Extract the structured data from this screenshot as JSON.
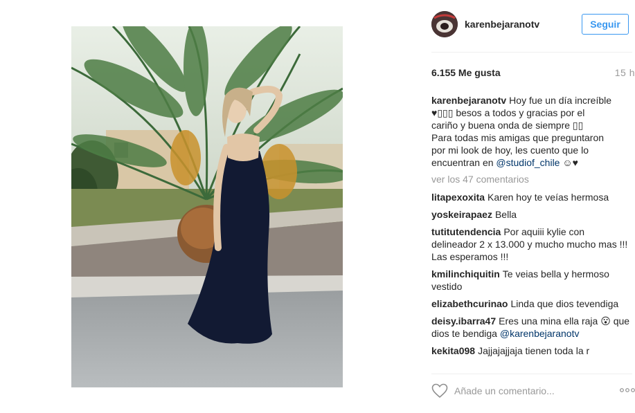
{
  "post": {
    "owner": "karenbejaranotv",
    "follow_label": "Seguir",
    "likes": "6.155 Me gusta",
    "time_ago": "15 h"
  },
  "caption": {
    "user": "karenbejaranotv",
    "line1": "Hoy fue un día increíble",
    "line2": "♥▯▯▯ besos a todos y gracias por el",
    "line3": "cariño y buena onda de siempre ▯▯",
    "line4": "Para todas mis amigas que preguntaron",
    "line5": "por mi look de hoy, les cuento que lo",
    "line6_prefix": "encuentran en",
    "line6_mention": "@studiof_chile",
    "line6_suffix": "☺♥"
  },
  "load_more": "ver los 47 comentarios",
  "comments": [
    {
      "user": "litapexoxita",
      "text": "Karen hoy te veías hermosa"
    },
    {
      "user": "yoskeirapaez",
      "text": "Bella"
    },
    {
      "user": "tutitutendencia",
      "text": "Por aquiii kylie con delineador 2 x 13.000 y mucho mucho mas !!! Las esperamos !!!"
    },
    {
      "user": "kmilinchiquitin",
      "text": "Te veias bella y hermoso vestido"
    },
    {
      "user": "elizabethcurinao",
      "text": "Linda que dios tevendiga"
    },
    {
      "user": "deisy.ibarra47",
      "text": "Eres una mina ella raja 😮 que dios te bendiga",
      "mention": "@karenbejaranotv"
    },
    {
      "user": "kekita098",
      "text": "Jajjajajjaja tienen toda la r"
    }
  ],
  "add_comment_placeholder": "Añade un comentario...",
  "icons": {
    "like": "heart-icon",
    "more": "more-options-icon"
  },
  "colors": {
    "accent": "#3897f0",
    "mention": "#003569",
    "muted": "#999999"
  }
}
